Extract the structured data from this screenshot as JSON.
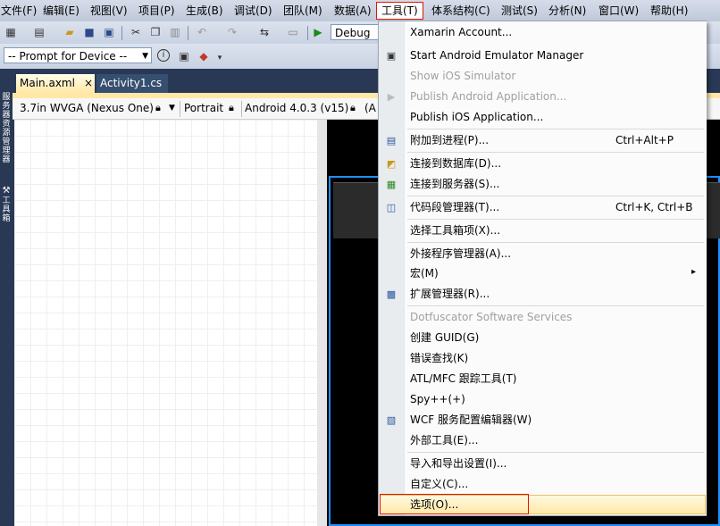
{
  "menubar": {
    "items": [
      "文件(F)",
      "编辑(E)",
      "视图(V)",
      "项目(P)",
      "生成(B)",
      "调试(D)",
      "团队(M)",
      "数据(A)",
      "工具(T)",
      "体系结构(C)",
      "测试(S)",
      "分析(N)",
      "窗口(W)",
      "帮助(H)"
    ],
    "active_index": 8
  },
  "toolbar": {
    "config_value": "Debug",
    "device_value": "-- Prompt for Device --"
  },
  "left_rail": {
    "labels": [
      "服务器资源管理器",
      "工具箱"
    ]
  },
  "tabs": [
    {
      "label": "Main.axml",
      "close": "×",
      "active": true
    },
    {
      "label": "Activity1.cs",
      "active": false
    }
  ],
  "device_bar": {
    "screen": "3.7in WVGA (Nexus One)",
    "orientation": "Portrait",
    "api": "Android 4.0.3 (v15)",
    "extra": "(A"
  },
  "tools_menu": {
    "items": [
      {
        "label": "Xamarin Account...",
        "shortcut": "",
        "disabled": false,
        "icon": ""
      },
      {
        "label": "Start Android Emulator Manager",
        "shortcut": "",
        "disabled": false,
        "icon": "android-emulator-icon"
      },
      {
        "label": "Show iOS Simulator",
        "shortcut": "",
        "disabled": true,
        "icon": ""
      },
      {
        "label": "Publish Android Application...",
        "shortcut": "",
        "disabled": true,
        "icon": "publish-arrow-icon"
      },
      {
        "label": "Publish iOS Application...",
        "shortcut": "",
        "disabled": false,
        "icon": ""
      },
      {
        "label": "附加到进程(P)...",
        "shortcut": "Ctrl+Alt+P",
        "disabled": false,
        "icon": "attach-process-icon"
      },
      {
        "label": "连接到数据库(D)...",
        "shortcut": "",
        "disabled": false,
        "icon": "database-icon"
      },
      {
        "label": "连接到服务器(S)...",
        "shortcut": "",
        "disabled": false,
        "icon": "server-icon"
      },
      {
        "label": "代码段管理器(T)...",
        "shortcut": "Ctrl+K, Ctrl+B",
        "disabled": false,
        "icon": "code-snippet-icon"
      },
      {
        "label": "选择工具箱项(X)...",
        "shortcut": "",
        "disabled": false,
        "icon": ""
      },
      {
        "label": "外接程序管理器(A)...",
        "shortcut": "",
        "disabled": false,
        "icon": ""
      },
      {
        "label": "宏(M)",
        "shortcut": "",
        "disabled": false,
        "icon": "",
        "submenu": true
      },
      {
        "label": "扩展管理器(R)...",
        "shortcut": "",
        "disabled": false,
        "icon": "extension-icon"
      },
      {
        "label": "Dotfuscator Software Services",
        "shortcut": "",
        "disabled": true,
        "icon": ""
      },
      {
        "label": "创建 GUID(G)",
        "shortcut": "",
        "disabled": false,
        "icon": ""
      },
      {
        "label": "错误查找(K)",
        "shortcut": "",
        "disabled": false,
        "icon": ""
      },
      {
        "label": "ATL/MFC 跟踪工具(T)",
        "shortcut": "",
        "disabled": false,
        "icon": ""
      },
      {
        "label": "Spy++(+)",
        "shortcut": "",
        "disabled": false,
        "icon": ""
      },
      {
        "label": "WCF 服务配置编辑器(W)",
        "shortcut": "",
        "disabled": false,
        "icon": "wcf-icon"
      },
      {
        "label": "外部工具(E)...",
        "shortcut": "",
        "disabled": false,
        "icon": ""
      },
      {
        "label": "导入和导出设置(I)...",
        "shortcut": "",
        "disabled": false,
        "icon": ""
      },
      {
        "label": "自定义(C)...",
        "shortcut": "",
        "disabled": false,
        "icon": ""
      },
      {
        "label": "选项(O)...",
        "shortcut": "",
        "disabled": false,
        "icon": "",
        "highlighted": true
      }
    ],
    "submenu_arrow": "▸"
  },
  "colors": {
    "highlight_border": "#e51400",
    "chrome_dark": "#293955"
  }
}
